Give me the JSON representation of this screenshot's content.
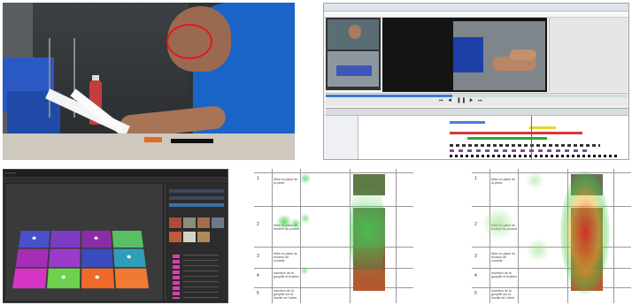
{
  "colors": {
    "gaze_circle": "#e0191b",
    "timeline_blue": "#4a7fd8",
    "timeline_yellow": "#e8d23a",
    "timeline_red": "#d93838",
    "timeline_green": "#2aa83c",
    "timeline_purple": "#7a49a8",
    "heat_green": "#3fd14a",
    "heat_red": "#e3241b"
  },
  "software": {
    "controls": "⏮ ◀ ▐▐ ▶ ⏭"
  },
  "app3d": {
    "tabs": "▪ ▪ ▪ ▪ ▪"
  },
  "doc1": {
    "rows": [
      {
        "num": "1",
        "text": "Mise en place de la pièce"
      },
      {
        "num": "2",
        "text": "Mise en place du tendeur du produit"
      },
      {
        "num": "3",
        "text": "Mise en place du tendeur de contrôle"
      },
      {
        "num": "4",
        "text": "Insertion de la goupille et fixation"
      },
      {
        "num": "5",
        "text": "Insertion de la goupille sur la douille de l'arbre"
      }
    ]
  }
}
